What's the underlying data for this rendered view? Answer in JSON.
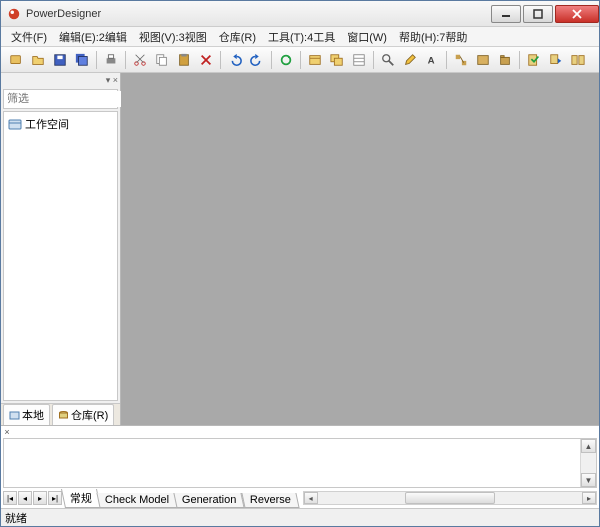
{
  "window": {
    "title": "PowerDesigner"
  },
  "menu": {
    "file": "文件(F)",
    "edit": "编辑(E):2编辑",
    "view": "视图(V):3视图",
    "repository": "仓库(R)",
    "tools": "工具(T):4工具",
    "window": "窗口(W)",
    "help": "帮助(H):7帮助"
  },
  "toolbar": {
    "icons": [
      "folder",
      "folder-open",
      "save",
      "save-all",
      "print",
      "cut",
      "copy",
      "paste",
      "delete",
      "undo",
      "redo",
      "refresh",
      "zoom-in",
      "zoom-out",
      "properties",
      "find",
      "compare",
      "merge",
      "text",
      "font",
      "bold",
      "align",
      "grid",
      "model",
      "diagram",
      "check",
      "generate"
    ]
  },
  "sidebar": {
    "filter_label": "筛选",
    "filter_value": "",
    "tree": {
      "root": "工作空间"
    },
    "tabs": {
      "local": "本地",
      "repository": "仓库(R)"
    }
  },
  "output": {
    "tabs": {
      "general": "常规",
      "check": "Check Model",
      "generation": "Generation",
      "reverse": "Reverse"
    }
  },
  "status": {
    "text": "就绪"
  },
  "colors": {
    "canvas": "#a9a9a9",
    "close_btn": "#c83028"
  }
}
